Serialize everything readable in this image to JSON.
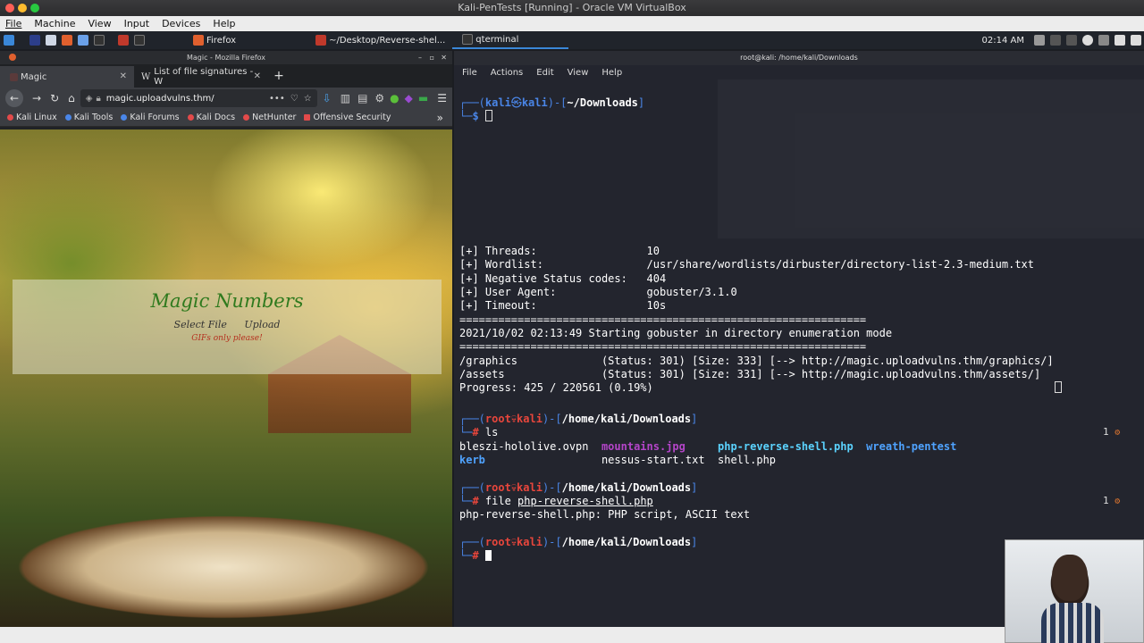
{
  "vbox": {
    "title": "Kali-PenTests [Running] - Oracle VM VirtualBox",
    "menu": [
      "File",
      "Machine",
      "View",
      "Input",
      "Devices",
      "Help"
    ]
  },
  "panel": {
    "tasks": [
      {
        "label": "Firefox"
      },
      {
        "label": "~/Desktop/Reverse-shel..."
      },
      {
        "label": "qterminal"
      }
    ],
    "clock": "02:14 AM"
  },
  "firefox": {
    "window_title": "Magic - Mozilla Firefox",
    "tabs": [
      {
        "label": "Magic"
      },
      {
        "label": "List of file signatures - W"
      }
    ],
    "url": "magic.uploadvulns.thm/",
    "bookmarks": [
      "Kali Linux",
      "Kali Tools",
      "Kali Forums",
      "Kali Docs",
      "NetHunter",
      "Offensive Security"
    ],
    "page": {
      "title": "Magic Numbers",
      "select_file": "Select File",
      "upload": "Upload",
      "note": "GIFs only please!"
    }
  },
  "terminal": {
    "window_title": "root@kali: /home/kali/Downloads",
    "menu": [
      "File",
      "Actions",
      "Edit",
      "View",
      "Help"
    ],
    "top_prompt": {
      "user": "kali",
      "host": "kali",
      "dir": "~/Downloads"
    },
    "gobuster": {
      "threads_label": "[+] Threads:",
      "threads": "10",
      "wordlist_label": "[+] Wordlist:",
      "wordlist": "/usr/share/wordlists/dirbuster/directory-list-2.3-medium.txt",
      "neg_label": "[+] Negative Status codes:",
      "neg": "404",
      "ua_label": "[+] User Agent:",
      "ua": "gobuster/3.1.0",
      "timeout_label": "[+] Timeout:",
      "timeout": "10s",
      "separator": "===============================================================",
      "start": "2021/10/02 02:13:49 Starting gobuster in directory enumeration mode",
      "results": [
        {
          "path": "/graphics",
          "info": "(Status: 301) [Size: 333] [--> http://magic.uploadvulns.thm/graphics/]"
        },
        {
          "path": "/assets",
          "info": "(Status: 301) [Size: 331] [--> http://magic.uploadvulns.thm/assets/]"
        }
      ],
      "progress": "Progress: 425 / 220561 (0.19%)"
    },
    "root_prompt": {
      "user": "root",
      "host": "kali",
      "dir": "/home/kali/Downloads"
    },
    "cmd_ls": "ls",
    "ls_files": {
      "a1": "bleszi-hololive.ovpn",
      "a2": "mountains.jpg",
      "a3": "php-reverse-shell.php",
      "a4": "wreath-pentest",
      "b1": "kerb",
      "b2": "nessus-start.txt",
      "b3": "shell.php"
    },
    "cmd_file": "file",
    "cmd_file_arg": "php-reverse-shell.php",
    "file_output": "php-reverse-shell.php: PHP script, ASCII text",
    "badge": "1"
  }
}
